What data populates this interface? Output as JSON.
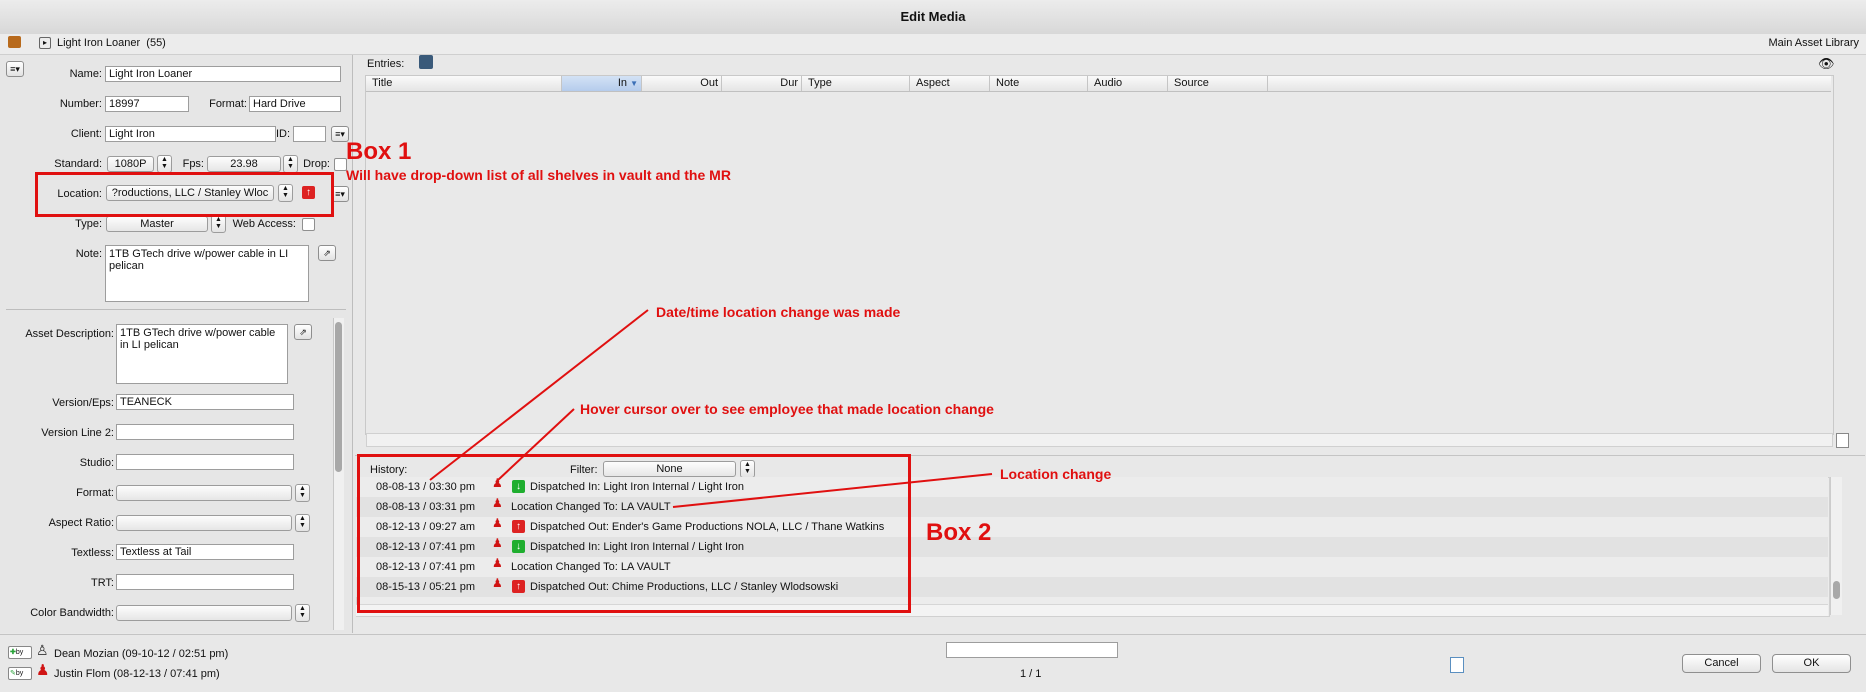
{
  "window": {
    "title": "Edit Media"
  },
  "header": {
    "record_label": "Light Iron Loaner  (55)",
    "library": "Main Asset Library"
  },
  "form": {
    "name_label": "Name:",
    "name_value": "Light Iron Loaner",
    "number_label": "Number:",
    "number_value": "18997",
    "format_label": "Format:",
    "format_value": "Hard Drive",
    "client_label": "Client:",
    "client_value": "Light Iron",
    "id_label": "ID:",
    "id_value": "",
    "standard_label": "Standard:",
    "standard_value": "1080P",
    "fps_label": "Fps:",
    "fps_value": "23.98",
    "drop_label": "Drop:",
    "location_label": "Location:",
    "location_value": "?roductions, LLC / Stanley Wloc",
    "type_label": "Type:",
    "type_value": "Master",
    "web_access_label": "Web Access:",
    "note_label": "Note:",
    "note_value": "1TB GTech drive w/power cable in LI pelican"
  },
  "asset": {
    "description_label": "Asset Description:",
    "description_value": "1TB GTech drive w/power cable in LI pelican",
    "version_label": "Version/Eps:",
    "version_value": "TEANECK",
    "version2_label": "Version Line 2:",
    "version2_value": "",
    "studio_label": "Studio:",
    "studio_value": "",
    "format_label": "Format:",
    "format_value": "",
    "aspect_label": "Aspect Ratio:",
    "aspect_value": "",
    "textless_label": "Textless:",
    "textless_value": "Textless at Tail",
    "trt_label": "TRT:",
    "trt_value": "",
    "color_label": "Color Bandwidth:",
    "color_value": ""
  },
  "entries": {
    "label": "Entries:",
    "columns": [
      "Title",
      "In",
      "Out",
      "Dur",
      "Type",
      "Aspect",
      "Note",
      "Audio",
      "Source"
    ]
  },
  "history": {
    "label": "History:",
    "filter_label": "Filter:",
    "filter_value": "None",
    "rows": [
      {
        "datetime": "08-08-13 / 03:30 pm",
        "icon": "dispatched-in-icon",
        "text": "Dispatched In: Light Iron Internal / Light Iron"
      },
      {
        "datetime": "08-08-13 / 03:31 pm",
        "icon": "",
        "text": "Location Changed To: LA VAULT"
      },
      {
        "datetime": "08-12-13 / 09:27 am",
        "icon": "dispatched-out-icon",
        "text": "Dispatched Out: Ender's Game Productions NOLA, LLC / Thane Watkins"
      },
      {
        "datetime": "08-12-13 / 07:41 pm",
        "icon": "dispatched-in-icon",
        "text": "Dispatched In: Light Iron Internal / Light Iron"
      },
      {
        "datetime": "08-12-13 / 07:41 pm",
        "icon": "",
        "text": "Location Changed To: LA VAULT"
      },
      {
        "datetime": "08-15-13 / 05:21 pm",
        "icon": "dispatched-out-icon",
        "text": "Dispatched Out: Chime Productions, LLC / Stanley Wlodsowski"
      }
    ]
  },
  "footer": {
    "created_by": "Dean Mozian (09-10-12 / 02:51 pm)",
    "modified_by": "Justin Flom (08-12-13 / 07:41 pm)",
    "by_badge": "by",
    "page": "1 / 1",
    "cancel": "Cancel",
    "ok": "OK"
  },
  "annotations": {
    "box1_title": "Box 1",
    "box1_text": "Will have drop-down list of all shelves in vault and the MR",
    "datetime_note": "Date/time location change was made",
    "hover_note": "Hover cursor over to see employee that made location change",
    "location_change": "Location change",
    "box2_title": "Box 2"
  },
  "colors": {
    "annotation": "#e01010",
    "in_icon": "#1fae2f",
    "out_icon": "#d22222"
  }
}
